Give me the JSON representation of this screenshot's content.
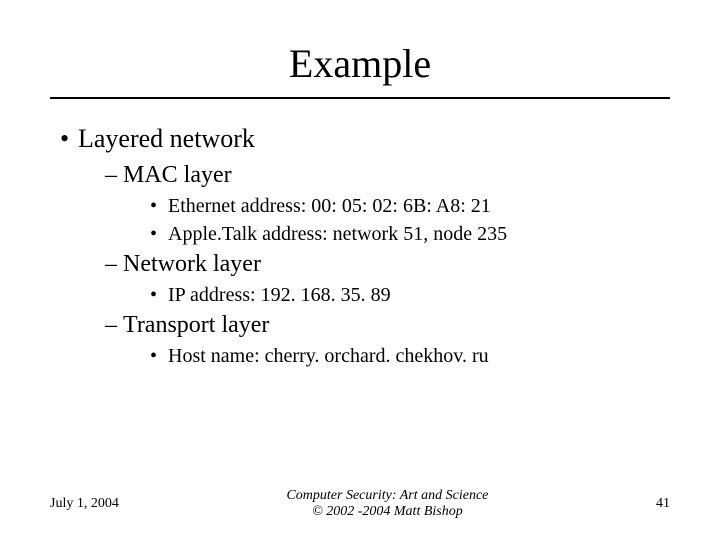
{
  "title": "Example",
  "content": {
    "l1": "Layered network",
    "l2a": "MAC layer",
    "l3a1": "Ethernet address: 00: 05: 02: 6B: A8: 21",
    "l3a2": "Apple.Talk address: network 51, node 235",
    "l2b": "Network layer",
    "l3b1": "IP address: 192. 168. 35. 89",
    "l2c": "Transport layer",
    "l3c1": "Host name: cherry. orchard. chekhov. ru"
  },
  "footer": {
    "date": "July 1, 2004",
    "center_line1": "Computer Security: Art and Science",
    "center_line2": "© 2002 -2004 Matt Bishop",
    "page": "41"
  }
}
